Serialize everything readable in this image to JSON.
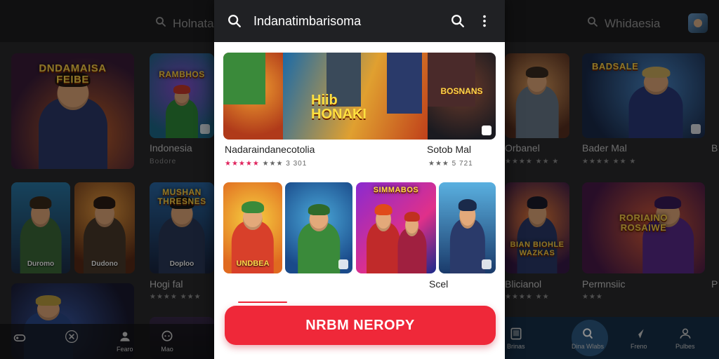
{
  "background": {
    "search_left": "Holnata",
    "search_right": "Whidaesia",
    "tiles_left": [
      {
        "title": "DNDAMAISA\nFEIBE",
        "sub": ""
      },
      {
        "title": "RAMBHOS",
        "sub": ""
      },
      {
        "title": "",
        "sub": "Duromo"
      },
      {
        "title": "",
        "sub": "Dudono"
      },
      {
        "title": "MUSHAN\nTHRESNES",
        "sub": "Doploo"
      }
    ],
    "labels_left": [
      "Indonesia",
      "Bodore",
      "Hogi fal"
    ],
    "tiles_right": [
      {
        "title": "",
        "sub": ""
      },
      {
        "title": "BADSALE",
        "sub": ""
      },
      {
        "title": "BIAN BIOHLE\nWAZKAS",
        "sub": ""
      },
      {
        "title": "RORIAINO\nROSAIWE",
        "sub": ""
      }
    ],
    "labels_right": [
      "Orbanel",
      "Bader Mal",
      "Blicianol",
      "Permnsiic"
    ],
    "labels_right_edge": [
      "B",
      "P"
    ],
    "nav_left": [
      {
        "label": "",
        "icon": "gamepad-icon"
      },
      {
        "label": "",
        "icon": "close-circle-icon"
      },
      {
        "label": "Fearo",
        "icon": "person-icon"
      },
      {
        "label": "Mao",
        "icon": "chat-icon"
      }
    ],
    "nav_right": [
      {
        "label": "Brinas",
        "icon": "tablet-icon"
      },
      {
        "label": "Dina Wlabs",
        "icon": "search-icon"
      },
      {
        "label": "Freno",
        "icon": "send-icon"
      },
      {
        "label": "Pulbes",
        "icon": "profile-icon"
      }
    ]
  },
  "panel": {
    "search_query": "Indanatimbarisoma",
    "row_a": {
      "banner_title": "Hiib\nHONAKI",
      "side_title": "BOSNANS",
      "label_left": "Nadaraindanecotolia",
      "label_right": "Sotob Mal",
      "rating_left": "★★★★★ ★★★ 3 301",
      "rating_right": "★★★ 5 721"
    },
    "row_b": {
      "tile1_sub": "UNDBEA",
      "tile3_title": "SIMMABOS",
      "label_right": "Scel"
    },
    "cta_label": "NRBM NEROPY"
  },
  "colors": {
    "cta": "#ef2839",
    "panel_header": "#202124",
    "accent_blue": "#2e5c86"
  }
}
